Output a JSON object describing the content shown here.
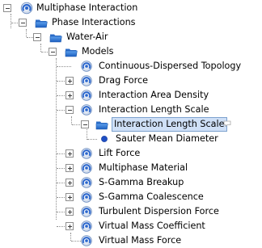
{
  "tree": {
    "root": {
      "label": "Multiphase Interaction",
      "icon": "multiphase-interaction-icon"
    },
    "phase_interactions": {
      "label": "Phase Interactions",
      "icon": "folder-open-icon"
    },
    "water_air": {
      "label": "Water-Air",
      "icon": "folder-open-icon"
    },
    "models": {
      "label": "Models",
      "icon": "folder-open-icon"
    },
    "model_items": [
      {
        "label": "Continuous-Dispersed Topology",
        "icon": "model-node-icon"
      },
      {
        "label": "Drag Force",
        "icon": "model-node-icon"
      },
      {
        "label": "Interaction Area Density",
        "icon": "model-node-icon"
      },
      {
        "label": "Interaction Length Scale",
        "icon": "model-node-icon"
      },
      {
        "label": "Interaction Length Scale",
        "icon": "folder-open-icon"
      },
      {
        "label": "Sauter Mean Diameter",
        "icon": "bullet-icon"
      },
      {
        "label": "Lift Force",
        "icon": "model-node-icon"
      },
      {
        "label": "Multiphase Material",
        "icon": "model-node-icon"
      },
      {
        "label": "S-Gamma Breakup",
        "icon": "model-node-icon"
      },
      {
        "label": "S-Gamma Coalescence",
        "icon": "model-node-icon"
      },
      {
        "label": "Turbulent Dispersion Force",
        "icon": "model-node-icon"
      },
      {
        "label": "Virtual Mass Coefficient",
        "icon": "model-node-icon"
      },
      {
        "label": "Virtual Mass Force",
        "icon": "model-node-icon"
      }
    ]
  },
  "colors": {
    "selection_bg": "#cfe0f7",
    "selection_border": "#7da2ce",
    "folder_blue": "#2f72c8",
    "node_blue": "#2d6ad1"
  }
}
